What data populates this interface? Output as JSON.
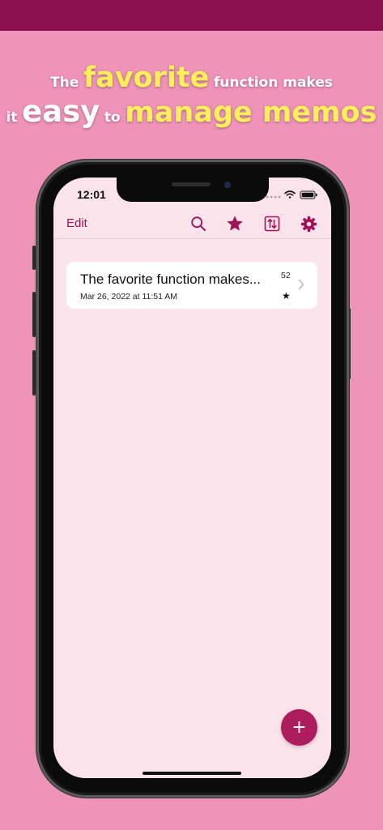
{
  "promo": {
    "line1": {
      "pre": "The",
      "highlight": "favorite",
      "post": "function makes"
    },
    "line2": {
      "pre": "it",
      "big": "easy",
      "mid": "to",
      "highlight": "manage memos"
    }
  },
  "status_bar": {
    "time": "12:01"
  },
  "navbar": {
    "edit_label": "Edit",
    "icons": [
      "search-icon",
      "star-icon",
      "sort-icon",
      "gear-icon"
    ]
  },
  "memos": [
    {
      "title": "The favorite function makes...",
      "date": "Mar 26, 2022 at 11:51 AM",
      "count": "52",
      "favorite_symbol": "★"
    }
  ],
  "fab": {
    "label": "+"
  },
  "colors": {
    "background": "#f093b8",
    "top_band": "#8c0f4f",
    "accent": "#a11354",
    "screen_bg": "#fbe3ec",
    "highlight_text": "#ffef5a"
  }
}
